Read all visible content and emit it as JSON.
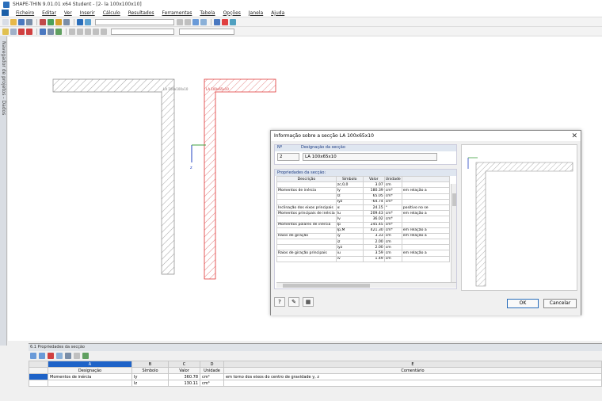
{
  "window": {
    "title": "SHAPE-THIN 9.01.01 x64 Student - [2- la 100x100x10]"
  },
  "menu": [
    "Ficheiro",
    "Editar",
    "Ver",
    "Inserir",
    "Cálculo",
    "Resultados",
    "Ferramentas",
    "Tabela",
    "Opções",
    "Janela",
    "Ajuda"
  ],
  "navigator": {
    "label": "Navegador de projetos - Dados"
  },
  "canvas": {
    "section_left_label": "LA 100x100x10",
    "section_right_label": "LA 100x65x10",
    "axis_label": "z"
  },
  "dialog": {
    "title": "Informação sobre a secção LA 100x65x10",
    "number_header": "Nº",
    "designation_header": "Designação da secção",
    "number_value": "2",
    "designation_value": "LA 100x65x10",
    "props_header": "Propriedades da secção:",
    "columns": [
      "Descrição",
      "Símbolo",
      "Valor",
      "Unidade",
      ""
    ],
    "rows": [
      [
        "",
        "zc,0,0",
        "3.07",
        "cm",
        ""
      ],
      [
        "Momentos de inércia",
        "Iy",
        "180.39",
        "cm⁴",
        "em relação a"
      ],
      [
        "",
        "Iz",
        "65.05",
        "cm⁴",
        ""
      ],
      [
        "",
        "Iyz",
        "-64.74",
        "cm⁴",
        ""
      ],
      [
        "Inclinação dos eixos principais",
        "α",
        "24.15",
        "°",
        "positivo no se"
      ],
      [
        "Momentos principais de inércia",
        "Iu",
        "209.43",
        "cm⁴",
        "em relação a"
      ],
      [
        "",
        "Iv",
        "36.02",
        "cm⁴",
        ""
      ],
      [
        "Momentos polares de inércia",
        "Ip",
        "245.45",
        "cm⁴",
        ""
      ],
      [
        "",
        "Ip,M",
        "421.30",
        "cm⁴",
        "em relação a"
      ],
      [
        "Raios de giração",
        "iy",
        "3.33",
        "cm",
        "em relação a"
      ],
      [
        "",
        "iz",
        "2.00",
        "cm",
        ""
      ],
      [
        "",
        "iyz",
        "2.00",
        "cm",
        ""
      ],
      [
        "Raios de giração principais",
        "iu",
        "3.59",
        "cm",
        "em relação a"
      ],
      [
        "",
        "iv",
        "1.49",
        "cm",
        ""
      ]
    ],
    "ok_label": "OK",
    "cancel_label": "Cancelar"
  },
  "lower_panel": {
    "title": "6.1 Propriedades da secção",
    "letters": [
      "A",
      "B",
      "C",
      "D",
      "E"
    ],
    "headers": [
      "Designação",
      "Símbolo",
      "Valor",
      "Unidade",
      "Comentário"
    ],
    "rows": [
      [
        "Momentos de inércia",
        "Iy",
        "360.78",
        "cm⁴",
        "em torno dos eixos do centro de gravidade y, z"
      ],
      [
        "",
        "Iz",
        "130.11",
        "cm⁴",
        ""
      ]
    ]
  }
}
